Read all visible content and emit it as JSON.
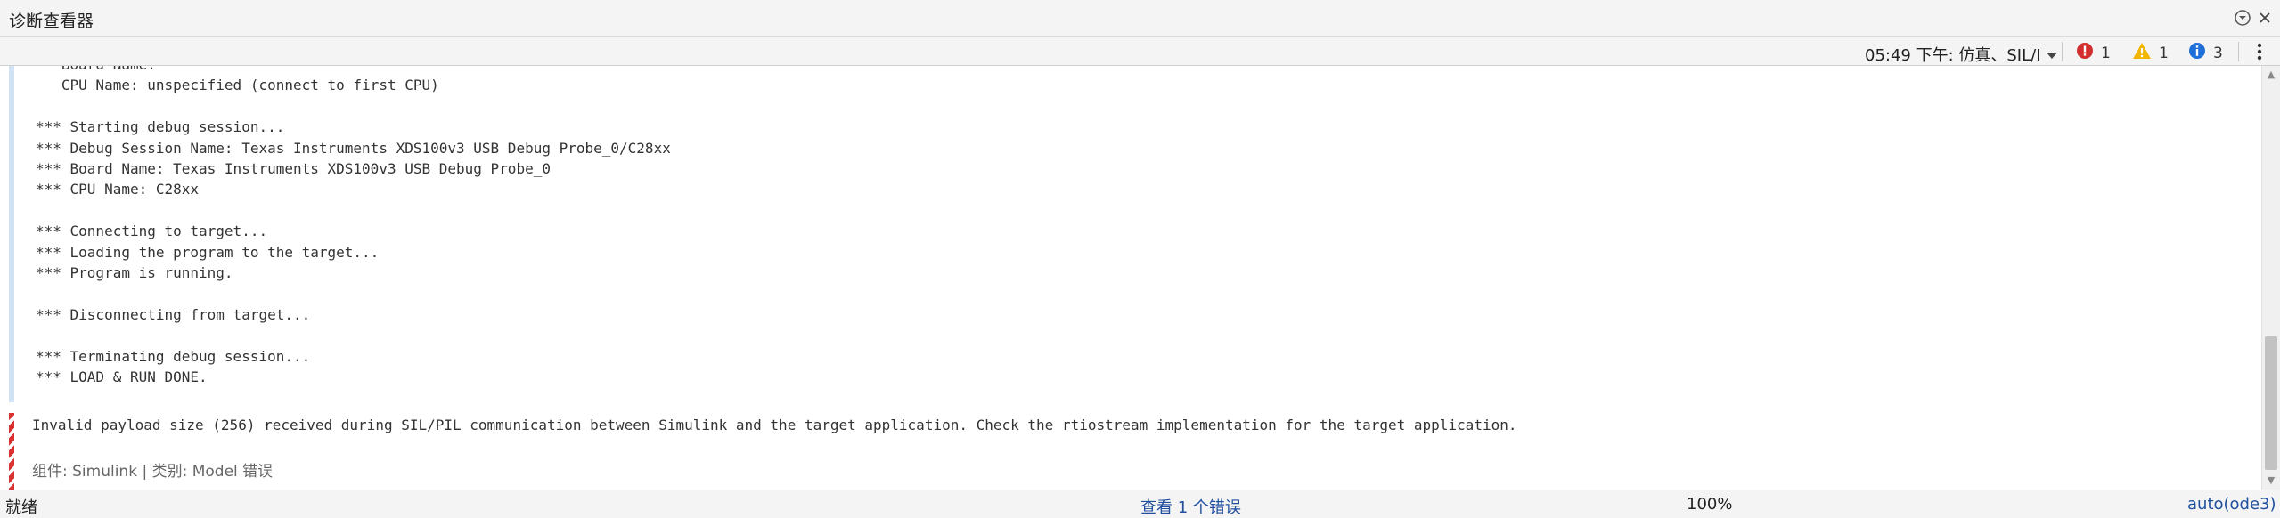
{
  "window": {
    "title": "诊断查看器",
    "menu_icon": "chevron-down-circle-icon",
    "close_icon": "close-icon"
  },
  "toolbar": {
    "time_filter": "05:49 下午: 仿真、SIL/I",
    "errors": {
      "icon": "error-icon",
      "count": "1",
      "color": "#d32f2f"
    },
    "warnings": {
      "icon": "warning-icon",
      "count": "1",
      "color": "#f2b600"
    },
    "info": {
      "icon": "info-icon",
      "count": "3",
      "color": "#1e6fd9"
    },
    "more_icon": "more-vertical-icon"
  },
  "log": {
    "lines": [
      "   Board Name:",
      "   CPU Name: unspecified (connect to first CPU)",
      "",
      "*** Starting debug session...",
      "*** Debug Session Name: Texas Instruments XDS100v3 USB Debug Probe_0/C28xx",
      "*** Board Name: Texas Instruments XDS100v3 USB Debug Probe_0",
      "*** CPU Name: C28xx",
      "",
      "*** Connecting to target...",
      "*** Loading the program to the target...",
      "*** Program is running.",
      "",
      "*** Disconnecting from target...",
      "",
      "*** Terminating debug session...",
      "*** LOAD & RUN DONE."
    ],
    "info_bar_color": "#cfe3f5"
  },
  "error": {
    "message": "Invalid payload size (256) received during SIL/PIL communication between Simulink and the target application. Check the rtiostream implementation for the target application.",
    "meta": "组件: Simulink | 类别: Model 错误",
    "stripe_color": "#d93030"
  },
  "status": {
    "left": "就绪",
    "center": "查看 1 个错误",
    "zoom": "100%",
    "solver": "auto(ode3)"
  }
}
